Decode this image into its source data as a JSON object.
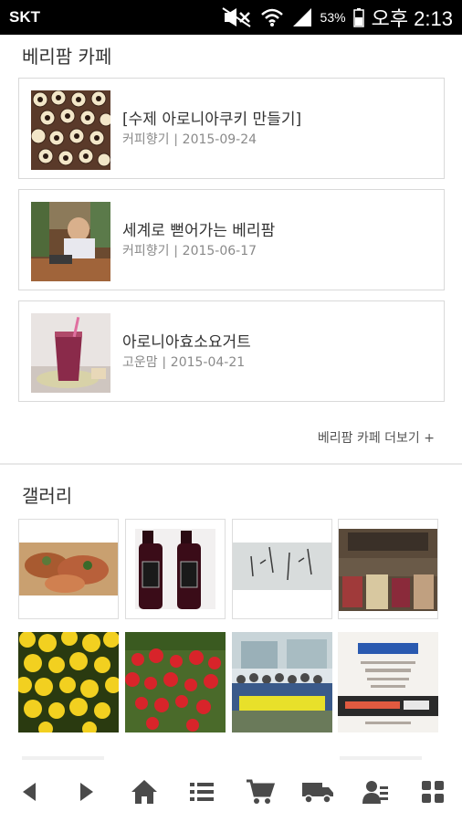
{
  "status_bar": {
    "carrier": "SKT",
    "battery": "53%",
    "time": "오후 2:13"
  },
  "cafe": {
    "title": "베리팜 카페",
    "posts": [
      {
        "title": "[수제 아로니아쿠키 만들기]",
        "author": "커피향기",
        "date": "2015-09-24"
      },
      {
        "title": "세계로 뻗어가는 베리팜",
        "author": "커피향기",
        "date": "2015-06-17"
      },
      {
        "title": "아로니아효소요거트",
        "author": "고운맘",
        "date": "2015-04-21"
      }
    ],
    "more_label": "베리팜 카페 더보기 +"
  },
  "gallery": {
    "title": "갤러리"
  },
  "bottom_nav": {
    "icons": [
      "back-icon",
      "forward-icon",
      "home-icon",
      "list-icon",
      "cart-icon",
      "delivery-truck-icon",
      "user-id-icon",
      "grid-menu-icon"
    ]
  }
}
